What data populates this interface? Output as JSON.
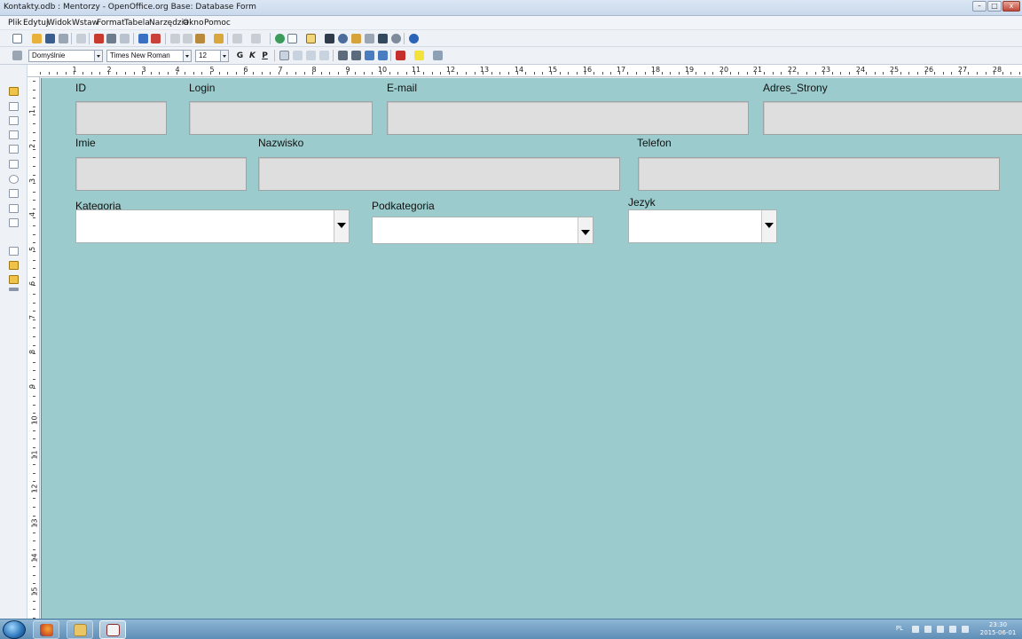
{
  "window": {
    "title": "Kontakty.odb : Mentorzy - OpenOffice.org Base: Database Form",
    "buttons": {
      "minimize": "–",
      "maximize": "□",
      "close": "x"
    }
  },
  "menu": {
    "items": [
      "Plik",
      "Edytuj",
      "Widok",
      "Wstaw",
      "Format",
      "Tabela",
      "Narzędzia",
      "Okno",
      "Pomoc"
    ]
  },
  "formatting": {
    "paragraph_style": "Domyślnie",
    "font_name": "Times New Roman",
    "font_size": "12",
    "bold_label": "G",
    "italic_label": "K",
    "underline_label": "P"
  },
  "ruler": {
    "h_numbers": [
      "1",
      "2",
      "3",
      "4",
      "5",
      "6",
      "7",
      "8",
      "9",
      "10",
      "11",
      "12",
      "13",
      "14",
      "15",
      "16",
      "17",
      "18",
      "19",
      "20",
      "21",
      "22",
      "23",
      "24",
      "25",
      "26",
      "27",
      "28"
    ],
    "v_numbers": [
      "1",
      "2",
      "3",
      "4",
      "5",
      "6",
      "7",
      "8",
      "9",
      "10",
      "11",
      "12",
      "13",
      "14",
      "15"
    ]
  },
  "form": {
    "background": "#9bcbcc",
    "labels": {
      "id": "ID",
      "login": "Login",
      "email": "E-mail",
      "website": "Adres_Strony",
      "first_name": "Imie",
      "last_name": "Nazwisko",
      "phone": "Telefon",
      "category": "Kategoria",
      "subcategory": "Podkategoria",
      "language": "Jezyk"
    },
    "values": {
      "id": "",
      "login": "",
      "email": "",
      "website": "",
      "first_name": "",
      "last_name": "",
      "phone": "",
      "category": "",
      "subcategory": "",
      "language": ""
    }
  },
  "taskbar": {
    "language": "PL",
    "time": "23:30",
    "date": "2015-06-01",
    "apps": [
      "firefox-icon",
      "file-explorer-icon",
      "openoffice-base-icon"
    ]
  }
}
